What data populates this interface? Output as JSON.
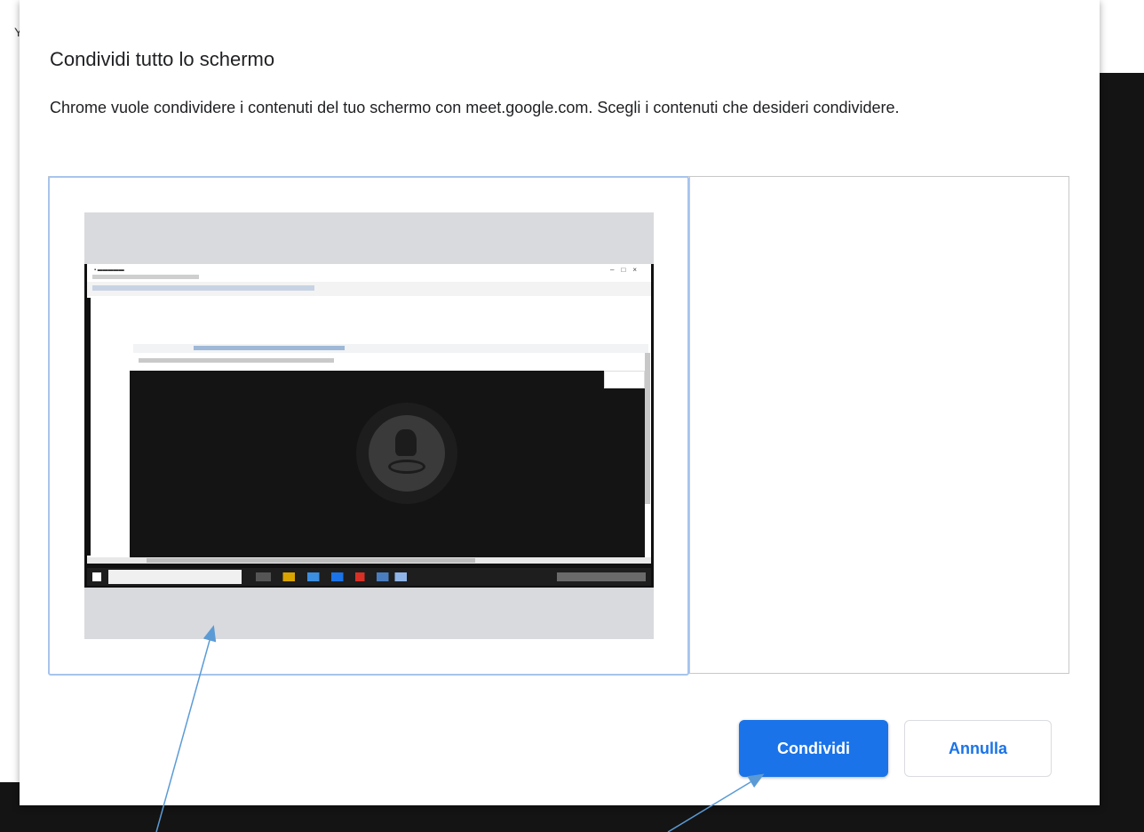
{
  "background": {
    "behind_char": "Y"
  },
  "dialog": {
    "title": "Condividi tutto lo schermo",
    "description": "Chrome vuole condividere i contenuti del tuo schermo con meet.google.com. Scegli i contenuti che desideri condividere.",
    "buttons": {
      "share": "Condividi",
      "cancel": "Annulla"
    }
  },
  "colors": {
    "accent": "#1a73e8",
    "tile_border": "#a7c4ec",
    "annotation_arrow": "#5b9bd5"
  },
  "icons": {
    "thumbnail_logo": "cyclist-logo-icon",
    "taskbar_start": "windows-start-icon"
  }
}
